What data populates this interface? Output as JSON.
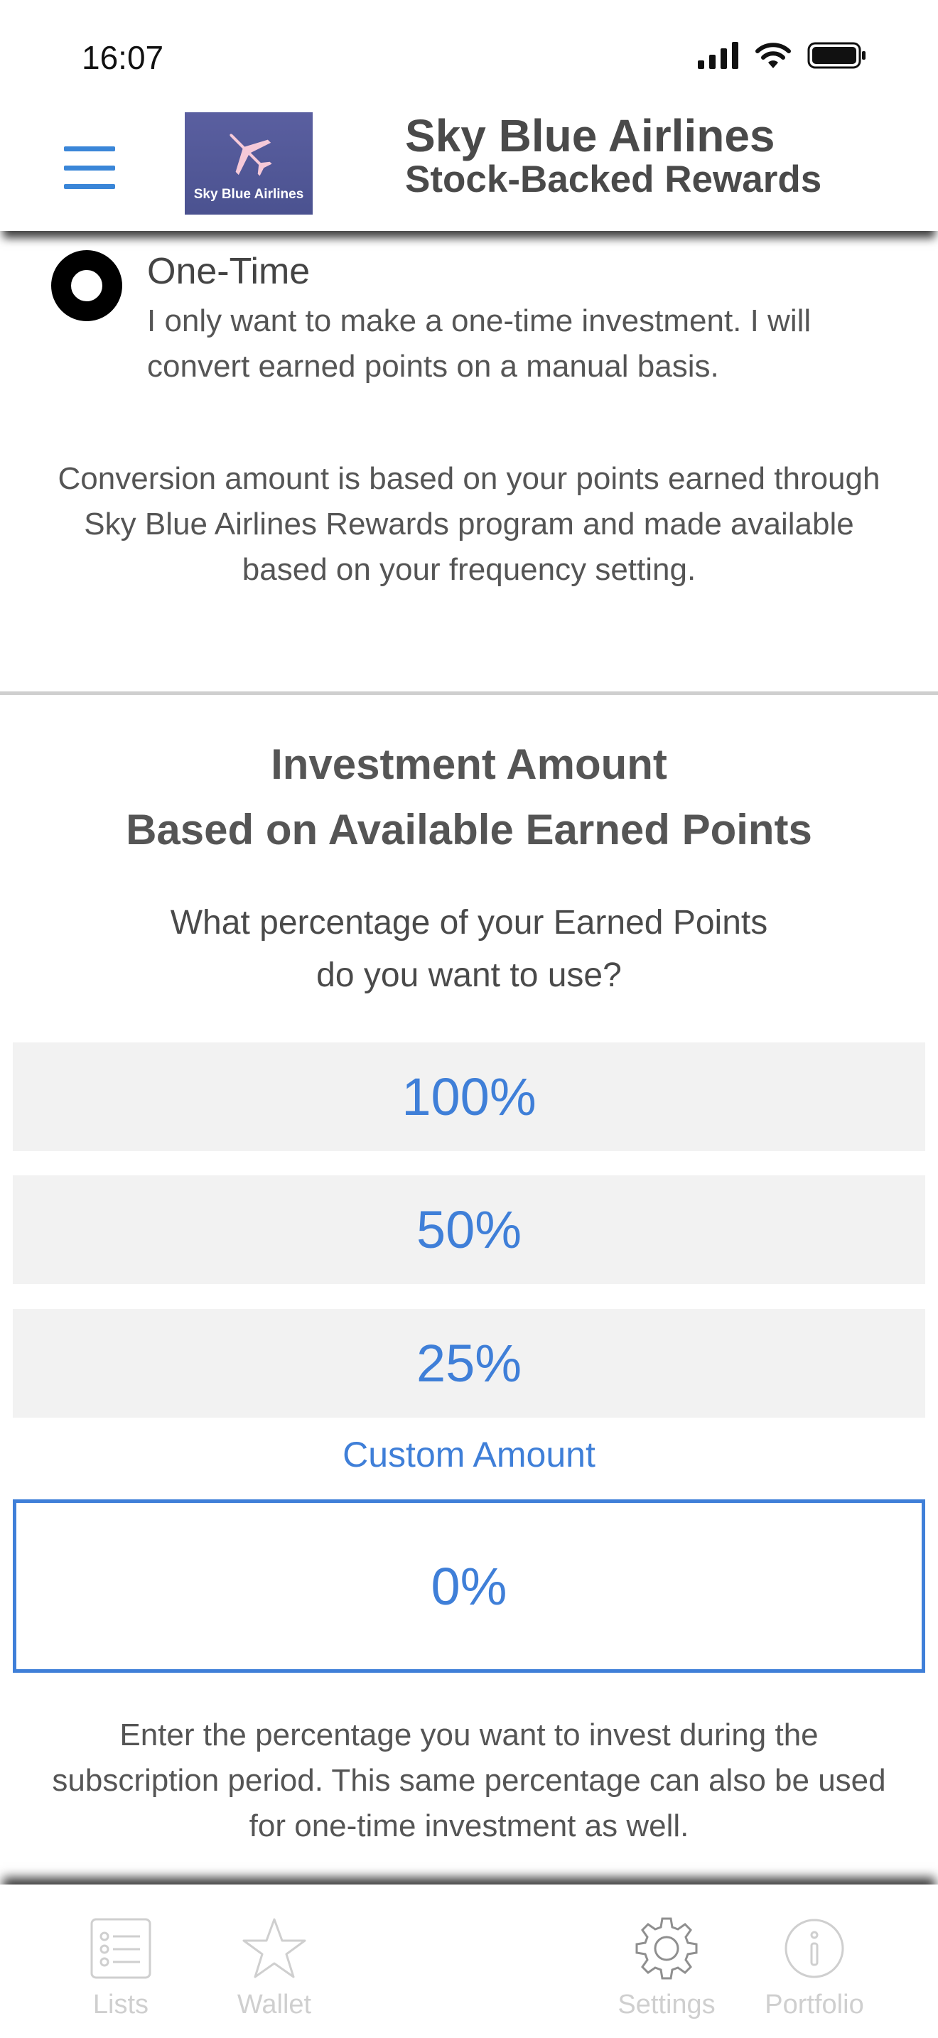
{
  "status_bar": {
    "time": "16:07"
  },
  "header": {
    "logo_text": "Sky Blue Airlines",
    "title": "Sky Blue Airlines",
    "subtitle": "Stock-Backed Rewards"
  },
  "frequency": {
    "option_title": "One-Time",
    "option_description": "I only want to make a one-time investment. I will convert earned points on a manual basis.",
    "conversion_note": "Conversion amount is based on your points earned through Sky Blue Airlines Rewards program and made available based on your frequency setting."
  },
  "investment": {
    "title_line1": "Investment Amount",
    "title_line2": "Based on Available Earned Points",
    "question_line1": "What percentage of your Earned Points",
    "question_line2": "do you want to use?",
    "options": [
      "100%",
      "50%",
      "25%"
    ],
    "custom_label": "Custom Amount",
    "custom_value": "0%",
    "custom_note": "Enter the percentage you want to invest during the subscription period. This same percentage can also be used for one-time investment as well."
  },
  "tabs": [
    {
      "label": "Lists",
      "icon": "list-icon"
    },
    {
      "label": "Wallet",
      "icon": "star-icon"
    },
    {
      "label": "Settings",
      "icon": "gear-icon"
    },
    {
      "label": "Portfolio",
      "icon": "info-icon"
    }
  ],
  "colors": {
    "accent": "#3f7fd8",
    "logo_bg": "#5a5fa0",
    "tab_inactive": "#cfcfcf"
  }
}
